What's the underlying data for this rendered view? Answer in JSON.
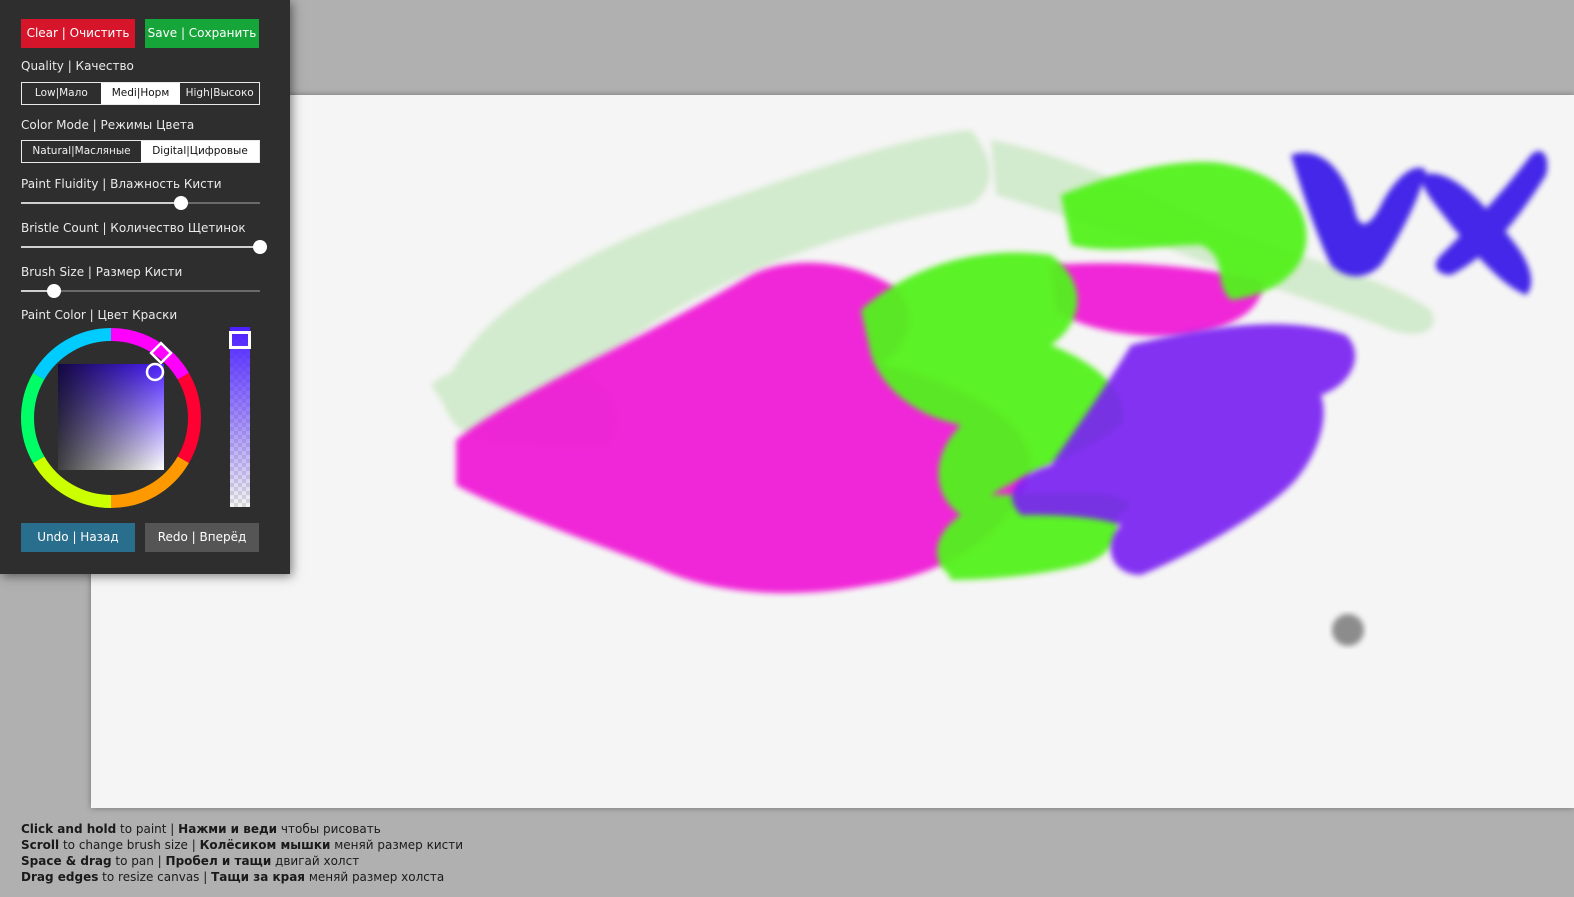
{
  "toolbar": {
    "clear_label": "Clear | Очистить",
    "save_label": "Save | Сохранить",
    "undo_label": "Undo | Назад",
    "redo_label": "Redo | Вперёд"
  },
  "quality": {
    "label": "Quality | Качество",
    "options": [
      "Low|Мало",
      "Medi|Норм",
      "High|Высоко"
    ],
    "selected": "Medi|Норм"
  },
  "color_mode": {
    "label": "Color Mode | Режимы Цвета",
    "options": [
      "Natural|Масляные",
      "Digital|Цифровые"
    ],
    "selected": "Digital|Цифровые"
  },
  "sliders": {
    "fluidity": {
      "label": "Paint Fluidity | Влажность Кисти",
      "value": 0.67
    },
    "bristle": {
      "label": "Bristle Count | Количество Щетинок",
      "value": 1.0
    },
    "brush_size": {
      "label": "Brush Size | Размер Кисти",
      "value": 0.14
    }
  },
  "paint_color": {
    "label": "Paint Color | Цвет Краски",
    "hex": "#4b1fff"
  },
  "colors": {
    "clear_button": "#d6152b",
    "save_button": "#16a539",
    "undo_button": "#2a6e8d",
    "redo_button": "#555555",
    "panel_bg": "#2e2e2e",
    "canvas_bg": "#f5f5f5"
  },
  "hints": [
    {
      "b1": "Click and hold",
      "t1": " to paint | ",
      "b2": "Нажми и веди",
      "t2": " чтобы рисовать"
    },
    {
      "b1": "Scroll",
      "t1": " to change brush size | ",
      "b2": "Колёсиком мышки",
      "t2": " меняй размер кисти"
    },
    {
      "b1": "Space & drag",
      "t1": " to pan | ",
      "b2": "Пробел и тащи",
      "t2": " двигай холст"
    },
    {
      "b1": "Drag edges",
      "t1": " to resize canvas | ",
      "b2": "Тащи за края",
      "t2": " меняй размер холста"
    }
  ]
}
